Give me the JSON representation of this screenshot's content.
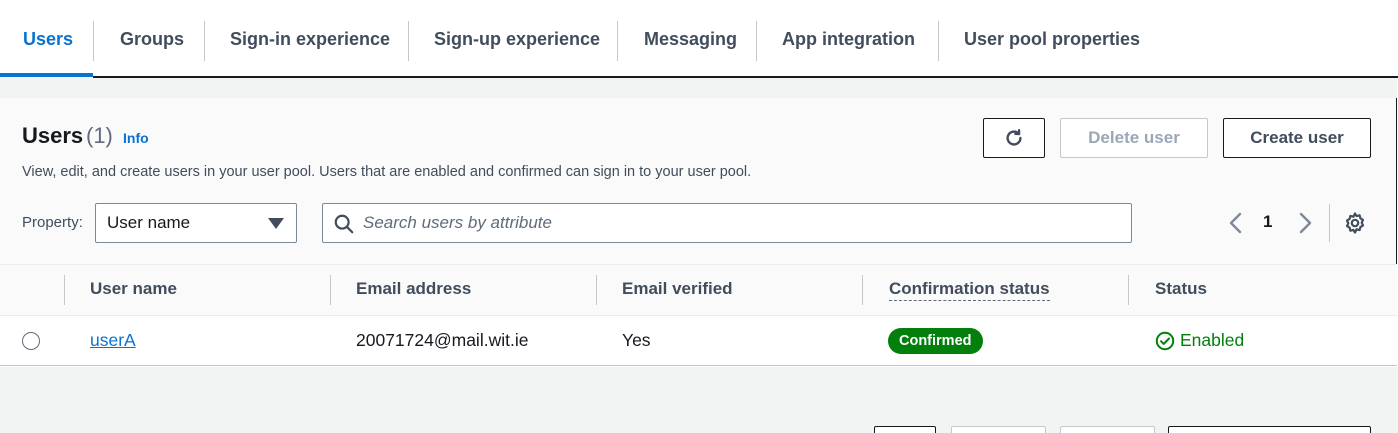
{
  "tabs": [
    {
      "label": "Users",
      "active": true
    },
    {
      "label": "Groups"
    },
    {
      "label": "Sign-in experience"
    },
    {
      "label": "Sign-up experience"
    },
    {
      "label": "Messaging"
    },
    {
      "label": "App integration"
    },
    {
      "label": "User pool properties"
    }
  ],
  "panel": {
    "title": "Users",
    "count": "(1)",
    "info_link": "Info",
    "description": "View, edit, and create users in your user pool. Users that are enabled and confirmed can sign in to your user pool.",
    "delete_label": "Delete user",
    "create_label": "Create user"
  },
  "filter": {
    "property_label": "Property:",
    "property_value": "User name",
    "search_placeholder": "Search users by attribute"
  },
  "pagination": {
    "current_page": "1"
  },
  "table": {
    "columns": [
      "User name",
      "Email address",
      "Email verified",
      "Confirmation status",
      "Status"
    ],
    "rows": [
      {
        "user_name": "userA",
        "email": "20071724@mail.wit.ie",
        "email_verified": "Yes",
        "confirmation_status": "Confirmed",
        "status": "Enabled"
      }
    ]
  },
  "colors": {
    "accent": "#0972d3",
    "success": "#037f0c"
  }
}
